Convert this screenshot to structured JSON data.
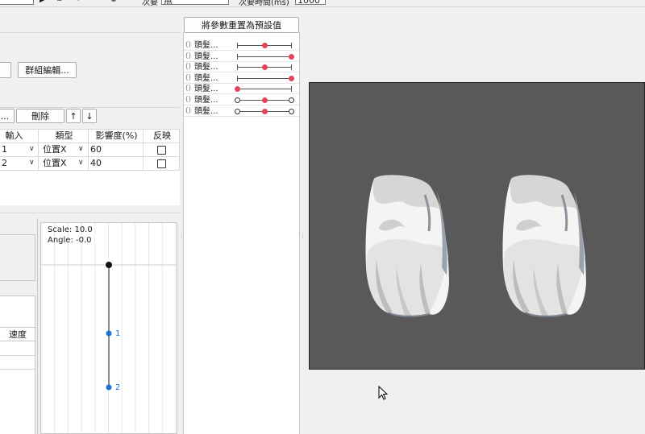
{
  "top": {
    "top_input1_label": "次要",
    "top_input1_value": "無",
    "top_input2_label": "次要時間(ms)",
    "top_input2_value": "1000"
  },
  "left_panel": {
    "group_edit_button": "群組編輯...",
    "toolbar_dots_button": "...",
    "delete_button": "刪除",
    "up_arrow": "↑",
    "down_arrow": "↓",
    "table": {
      "headers": [
        "輸入",
        "類型",
        "影響度(%)",
        "反映"
      ],
      "rows": [
        {
          "input": "1",
          "type": "位置X",
          "influence": "60",
          "checked": false
        },
        {
          "input": "2",
          "type": "位置X",
          "influence": "40",
          "checked": false
        }
      ]
    },
    "lower_table_header": "速度"
  },
  "graph": {
    "scale_text": "Scale: 10.0",
    "angle_text": "Angle: -0.0",
    "point1_label": "1",
    "point2_label": "2",
    "colors": {
      "root": "#111111",
      "point": "#1e73d2",
      "line": "#8c8c8c"
    }
  },
  "params": {
    "reset_button": "將參數重置為預設值",
    "rows": [
      {
        "label": "頭髮...",
        "value": 0.5,
        "style": "dot"
      },
      {
        "label": "頭髮...",
        "value": 1.0,
        "style": "dot"
      },
      {
        "label": "頭髮...",
        "value": 0.5,
        "style": "dot"
      },
      {
        "label": "頭髮...",
        "value": 1.0,
        "style": "dot"
      },
      {
        "label": "頭髮...",
        "value": 0.0,
        "style": "dot"
      },
      {
        "label": "頭髮...",
        "value": 0.5,
        "style": "ring"
      },
      {
        "label": "頭髮...",
        "value": 0.5,
        "style": "ring"
      }
    ],
    "accent": "#e0455a"
  },
  "canvas": {
    "background": "#595959"
  }
}
